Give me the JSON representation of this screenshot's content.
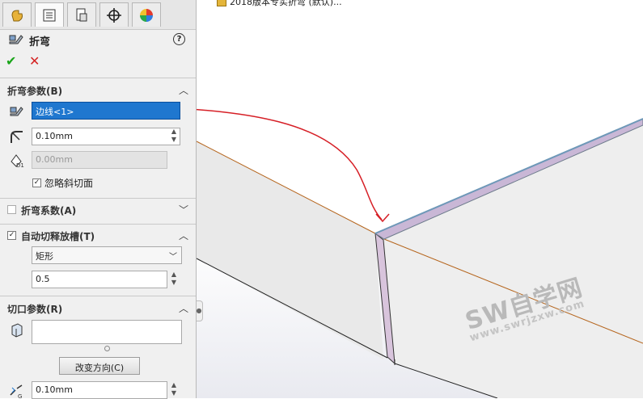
{
  "tree": {
    "item": "2018版本专实折弯 (默认)..."
  },
  "feature": {
    "title": "折弯"
  },
  "sections": {
    "bend_params": {
      "title": "折弯参数(B)",
      "edge_value": "边线<1>",
      "radius_value": "0.10mm",
      "offset_value": "0.00mm",
      "ignore_bevel_label": "忽略斜切面"
    },
    "bend_allowance": {
      "title": "折弯系数(A)"
    },
    "auto_relief": {
      "title": "自动切释放槽(T)",
      "type_value": "矩形",
      "ratio_value": "0.5"
    },
    "cut_params": {
      "title": "切口参数(R)",
      "body_value": "",
      "flip_button": "改变方向(C)",
      "gap_value": "0.10mm"
    }
  },
  "watermark": {
    "main": "SW自学网",
    "url": "www.swrjzxw.com"
  },
  "colors": {
    "accent": "#1f77cf",
    "ok": "#1aa51a",
    "cancel": "#d42424",
    "annotation": "#d61f26"
  }
}
